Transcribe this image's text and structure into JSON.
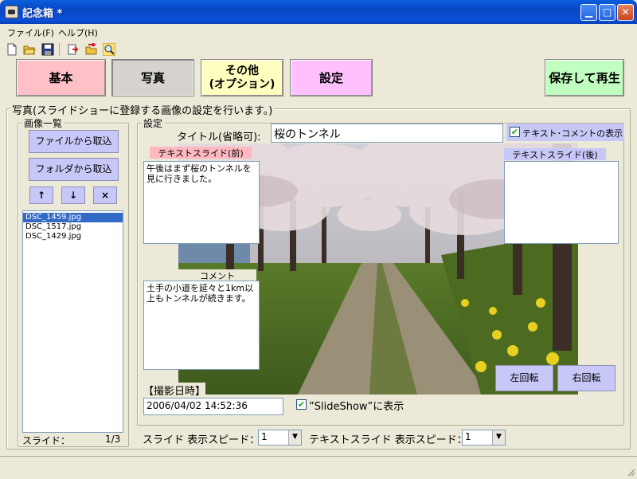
{
  "window": {
    "title": "記念箱 *"
  },
  "menu": {
    "file": "ファイル(F)",
    "help": "ヘルプ(H)"
  },
  "toolbar_icons": [
    "new-file-icon",
    "open-folder-icon",
    "save-icon",
    "export-icon",
    "import-icon",
    "search-icon"
  ],
  "tabs": {
    "kihon": "基本",
    "shashin": "写真",
    "sonota_line1": "その他",
    "sonota_line2": "(オプション)",
    "settei": "設定",
    "save_play": "保存して再生"
  },
  "main": {
    "group_title": "写真(スライドショーに登録する画像の設定を行います。)",
    "image_list": {
      "title": "画像一覧",
      "import_file": "ファイルから取込",
      "import_folder": "フォルダから取込",
      "up": "↑",
      "down": "↓",
      "delete": "×",
      "files": [
        "DSC_1459.jpg",
        "DSC_1517.jpg",
        "DSC_1429.jpg"
      ],
      "selected_index": 0,
      "slide_label": "スライド：",
      "slide_count": "1/3"
    },
    "settings": {
      "title": "設定",
      "title_label": "タイトル(省略可):",
      "title_value": "桜のトンネル",
      "show_text_comment": "テキスト･コメントの表示",
      "text_slide_before_label": "テキストスライド(前)",
      "text_slide_before_value": "午後はまず桜のトンネルを見に行きました。",
      "text_slide_after_label": "テキストスライド(後)",
      "text_slide_after_value": "",
      "comment_label": "コメント",
      "comment_value": "土手の小道を延々と1km以上もトンネルが続きます。",
      "date_label": "【撮影日時】",
      "date_value": "2006/04/02 14:52:36",
      "slideshow_label": "”SlideShow”に表示",
      "rotate_left": "左回転",
      "rotate_right": "右回転"
    },
    "speed": {
      "slide_label": "スライド 表示スピード：",
      "slide_value": "1",
      "text_label": "テキストスライド 表示スピード：",
      "text_value": "1"
    }
  }
}
